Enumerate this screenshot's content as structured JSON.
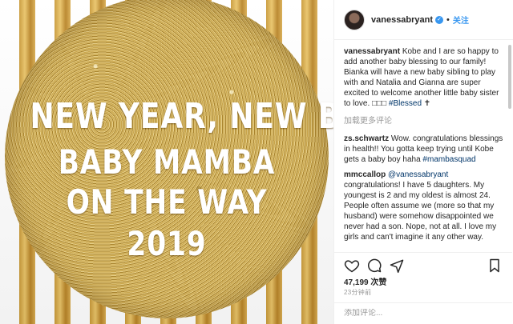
{
  "post": {
    "image": {
      "line1": "NEW YEAR, NEW BABY!",
      "line2": "BABY MAMBA",
      "line3": "ON THE WAY",
      "line4": "2019"
    },
    "header": {
      "username": "vanessabryant",
      "verified": "✓",
      "dot": "•",
      "follow_label": "关注"
    },
    "caption": {
      "user": "vanessabryant",
      "text": " Kobe and I are so happy to add another baby blessing to our family! Bianka will have a new baby sibling to play with and Natalia and Gianna are super excited to welcome another little baby sister to love. □□□ ",
      "hashtag": "#Blessed",
      "trail": " ✝"
    },
    "load_more": "加载更多评论",
    "comments": [
      {
        "user": "zs.schwartz",
        "text": " Wow. congratulations blessings in health!! You gotta keep trying until Kobe gets a baby boy haha ",
        "tag": "#mambasquad"
      },
      {
        "user": "mmccallop",
        "mention": " @vanessabryant",
        "text": " congratulations! I have 5 daughters. My youngest is 2 and my oldest is almost 24. People often assume we (more so that my husband) were somehow disappointed we never had a son. Nope, not at all. I love my girls and can't imagine it any other way."
      }
    ],
    "actions": {
      "like_icon": "heart-icon",
      "comment_icon": "comment-icon",
      "share_icon": "share-icon",
      "save_icon": "bookmark-icon"
    },
    "likes": "47,199 次赞",
    "timestamp": "23分钟前",
    "add_comment_placeholder": "添加评论..."
  },
  "colors": {
    "link": "#003569",
    "accent": "#3897f0",
    "gold": "#c99a3a"
  }
}
